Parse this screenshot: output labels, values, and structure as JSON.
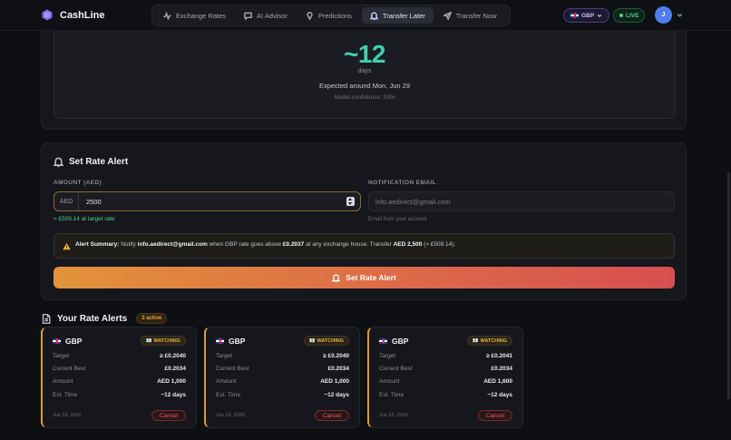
{
  "brand": {
    "name": "CashLine"
  },
  "nav": {
    "tabs": [
      {
        "label": "Exchange Rates",
        "icon": "activity-icon"
      },
      {
        "label": "AI Advisor",
        "icon": "message-icon"
      },
      {
        "label": "Predictions",
        "icon": "lightbulb-icon"
      },
      {
        "label": "Transfer Later",
        "icon": "bell-icon",
        "active": true
      },
      {
        "label": "Transfer Now",
        "icon": "send-icon"
      }
    ],
    "currency": "GBP",
    "live": "LIVE",
    "avatar_initial": "J"
  },
  "prediction": {
    "value": "~12",
    "unit": "days",
    "expected": "Expected around Mon, Jun 29",
    "confidence": "Model confidence: 93%"
  },
  "alert_form": {
    "title": "Set Rate Alert",
    "amount_label": "AMOUNT (AED)",
    "amount_prefix": "AED",
    "amount_value": "2500",
    "amount_hint": "≈ £509.14 at target rate",
    "email_label": "NOTIFICATION EMAIL",
    "email_placeholder": "info.aedirect@gmail.com",
    "email_hint": "Email from your account",
    "summary": {
      "label": "Alert Summary:",
      "t1": " Notify ",
      "email": "info.aedirect@gmail.com",
      "t2": " when GBP rate goes above ",
      "rate": "£0.2037",
      "t3": " at any exchange house. Transfer ",
      "amount": "AED 2,500",
      "t4": " (≈ £509.14)."
    },
    "button_label": "Set Rate Alert"
  },
  "rate_alerts": {
    "title": "Your Rate Alerts",
    "count_badge": "3 active",
    "labels": {
      "target": "Target",
      "current": "Current Best",
      "amount": "Amount",
      "time": "Est. Time"
    },
    "status_label": "WATCHING",
    "cancel_label": "Cancel",
    "items": [
      {
        "currency": "GBP",
        "target": "≥ £0.2040",
        "current": "£0.2034",
        "amount": "AED 1,000",
        "time": "~12 days",
        "date": "Jun 18, 2026"
      },
      {
        "currency": "GBP",
        "target": "≥ £0.2040",
        "current": "£0.2034",
        "amount": "AED 1,000",
        "time": "~12 days",
        "date": "Jun 16, 2026"
      },
      {
        "currency": "GBP",
        "target": "≥ £0.2041",
        "current": "£0.2034",
        "amount": "AED 1,600",
        "time": "~12 days",
        "date": "Jun 15, 2026"
      }
    ]
  },
  "colors": {
    "accent": "#3fcfb3",
    "warning": "#e7a33c",
    "danger": "#e85a5f",
    "success": "#4fcf86",
    "brand": "#7b6cf6"
  }
}
